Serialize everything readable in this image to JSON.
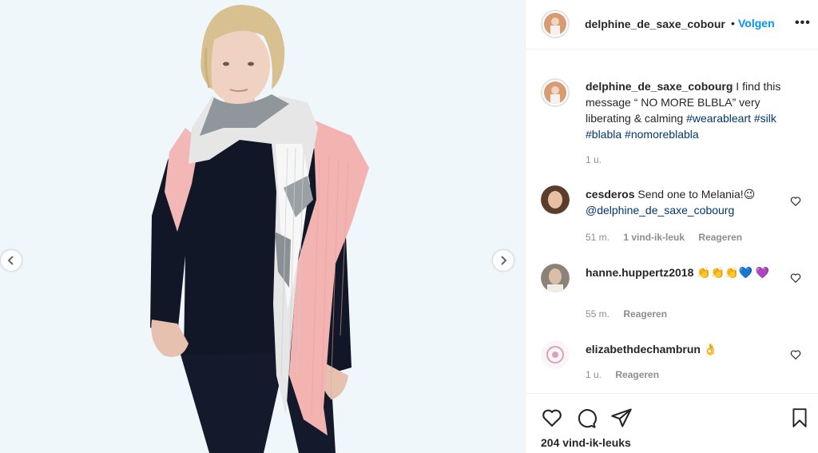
{
  "post": {
    "author": "delphine_de_saxe_cobourg",
    "author_header": "delphine_de_saxe_cobour",
    "separator": "•",
    "follow_label": "Volgen",
    "more_label": "•••",
    "likes": "204 vind-ik-leuks"
  },
  "caption": {
    "username": "delphine_de_saxe_cobourg",
    "text": "I find this message “ NO MORE BLBLA” very liberating & calming",
    "tags": [
      "#wearableart",
      "#silk",
      "#blabla",
      "#nomoreblabla"
    ],
    "time": "1 u."
  },
  "comments": [
    {
      "username": "cesderos",
      "text": "Send one to Melania!😉",
      "mention": "@delphine_de_saxe_cobourg",
      "time": "51 m.",
      "likes": "1 vind-ik-leuk",
      "reply_label": "Reageren"
    },
    {
      "username": "hanne.huppertz2018",
      "text": "👏👏👏💙 💜",
      "time": "55 m.",
      "reply_label": "Reageren"
    },
    {
      "username": "elizabethdechambrun",
      "text": "👌",
      "time": "1 u.",
      "reply_label": "Reageren"
    }
  ],
  "icons": {
    "prev": "chevron-left-icon",
    "next": "chevron-right-icon",
    "like": "heart-icon",
    "comment": "comment-icon",
    "share": "paper-plane-icon",
    "save": "bookmark-icon"
  },
  "colors": {
    "accent": "#0095f6",
    "hashtag": "#00376b",
    "muted": "#8e8e8e",
    "text": "#262626",
    "photo_bg": "#eff7fb"
  }
}
